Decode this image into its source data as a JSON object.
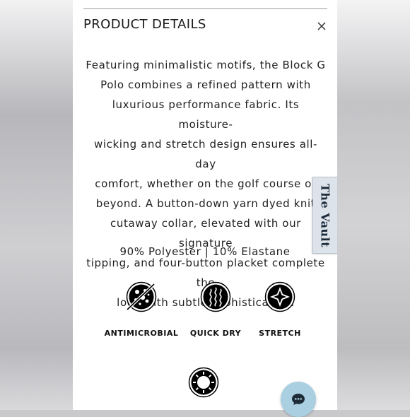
{
  "panel": {
    "title": "PRODUCT DETAILS",
    "description_lines": [
      "Featuring minimalistic motifs, the Block G",
      "Polo combines a refined pattern with",
      "luxurious performance fabric. Its moisture-",
      "wicking and stretch design ensures all-day",
      "comfort, whether on the golf course or",
      "beyond. A button-down yarn dyed knit",
      "cutaway collar, elevated with our signature",
      "tipping, and four-button placket complete the",
      "look with subtle sophistication."
    ],
    "fabric": "90% Polyester | 10% Elastane",
    "features": [
      {
        "label": "ANTIMICROBIAL",
        "icon": "antimicrobial-icon"
      },
      {
        "label": "QUICK DRY",
        "icon": "quick-dry-icon"
      },
      {
        "label": "STRETCH",
        "icon": "stretch-icon"
      }
    ],
    "extra_icon": "uv-protection-icon"
  },
  "side_tab": {
    "label": "The Vault"
  },
  "chat": {
    "icon": "chat-icon",
    "color": "#a9cfe0"
  },
  "colors": {
    "text": "#1f1f1f",
    "badge": "#000000"
  }
}
